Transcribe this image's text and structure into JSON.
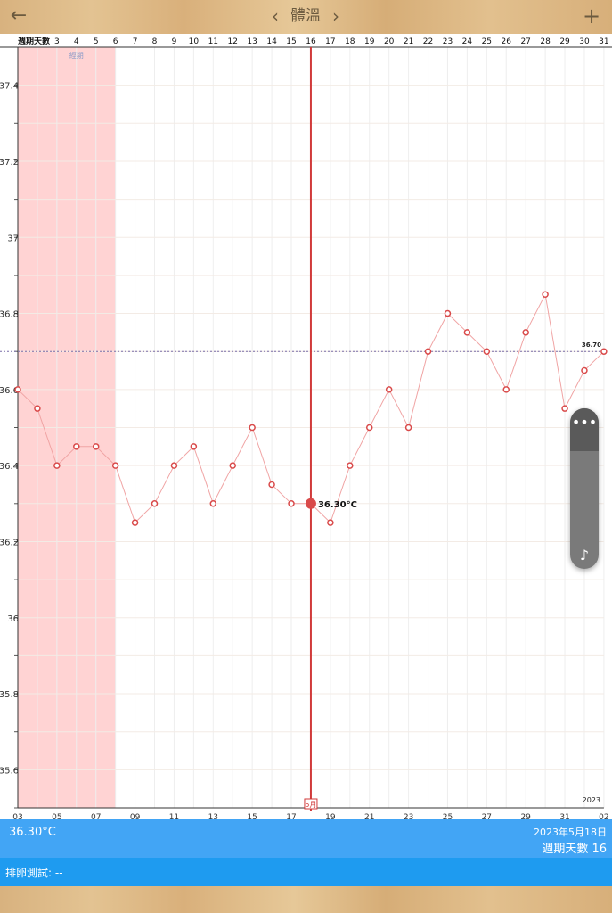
{
  "header": {
    "title": "體溫",
    "back_icon": "←",
    "prev_icon": "‹",
    "next_icon": "›",
    "add_icon": "+"
  },
  "chart_data": {
    "type": "line",
    "top_axis_label": "週期天數",
    "cycle_days": [
      3,
      4,
      5,
      6,
      7,
      8,
      9,
      10,
      11,
      12,
      13,
      14,
      15,
      16,
      17,
      18,
      19,
      20,
      21,
      22,
      23,
      24,
      25,
      26,
      27,
      28,
      29,
      30,
      31
    ],
    "period_marker_label": "經期",
    "period_day_range": [
      3,
      7
    ],
    "period_color": "#ffd3d3",
    "y_ticks": [
      "37.4",
      "37.2",
      "37",
      "36.8",
      "36.6",
      "36.4",
      "36.2",
      "36",
      "35.8",
      "35.6"
    ],
    "ylim": [
      35.5,
      37.5
    ],
    "x_tick_labels": [
      "03",
      "05",
      "07",
      "09",
      "11",
      "13",
      "15",
      "17",
      "19",
      "21",
      "23",
      "25",
      "27",
      "29",
      "31",
      "02"
    ],
    "date_index_range": [
      0,
      30
    ],
    "series": [
      {
        "color": "#e05a5a",
        "values": [
          36.6,
          36.55,
          36.4,
          36.45,
          36.45,
          36.4,
          36.25,
          36.3,
          36.4,
          36.45,
          36.3,
          36.4,
          36.5,
          36.35,
          36.3,
          36.3,
          36.25,
          36.4,
          36.5,
          36.6,
          36.5,
          36.7,
          36.8,
          36.75,
          36.7,
          36.6,
          36.75,
          36.85,
          36.55,
          36.65,
          36.7
        ]
      }
    ],
    "coverline_value": 36.7,
    "coverline_label": "36.70",
    "selected_index": 15,
    "selected_label": "36.30°C",
    "month_marker_index": 15,
    "month_marker_label": "5月",
    "year_label": "2023",
    "grid": true
  },
  "widget": {
    "dots_icon": "•••",
    "mode_icon": "♪"
  },
  "info": {
    "current_temp": "36.30°C",
    "date": "2023年5月18日",
    "cycle_day": "週期天數 16"
  },
  "ovulation": {
    "text": "排卵測試: --"
  }
}
